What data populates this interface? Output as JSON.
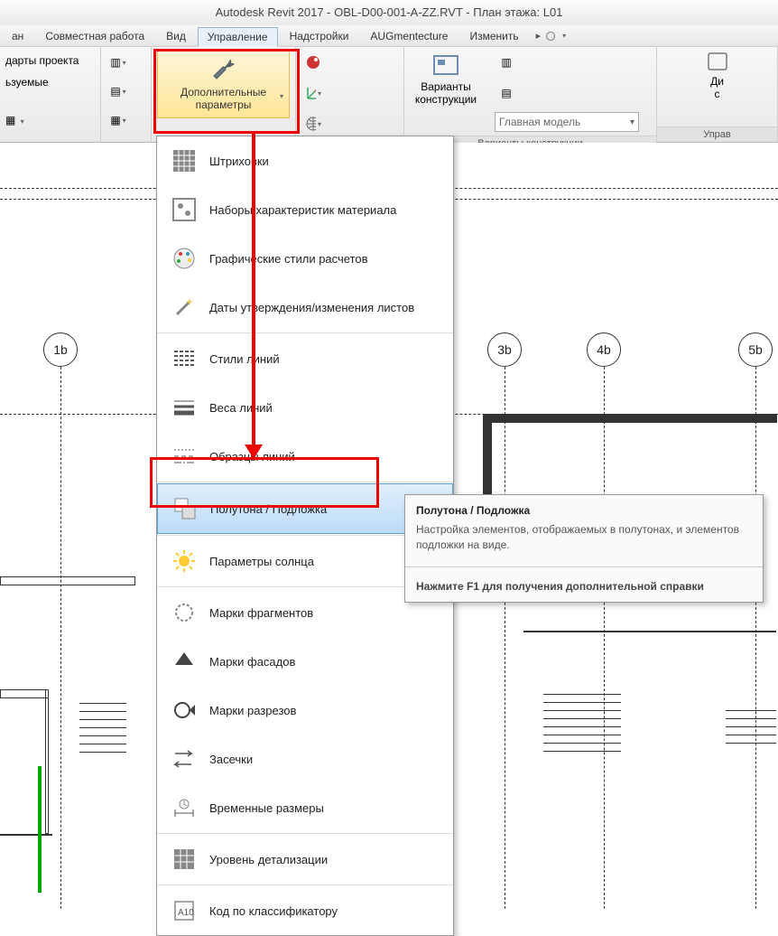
{
  "title": "Autodesk Revit 2017 -    OBL-D00-001-A-ZZ.RVT - План этажа: L01",
  "tabs": [
    "ан",
    "Совместная работа",
    "Вид",
    "Управление",
    "Надстройки",
    "AUGmentecture",
    "Изменить"
  ],
  "activeTabIndex": 3,
  "ribbon": {
    "leftPanelItems": [
      "дарты проекта",
      "ьзуемые"
    ],
    "extraParams": "Дополнительные\nпараметры",
    "designOptions": "Варианты\nконструкции",
    "designOptionsPanelLabel": "Варианты конструкции",
    "mainModelCombo": "Главная модель",
    "rightPanelLabel": "Управ",
    "rightBtnTop": "Ди",
    "rightBtnBot": "с"
  },
  "menu": {
    "items": [
      {
        "icon": "hatch",
        "label": "Штриховки"
      },
      {
        "icon": "material",
        "label": "Наборы характеристик материала"
      },
      {
        "icon": "palette",
        "label": "Графические стили расчетов"
      },
      {
        "icon": "wand",
        "label": "Даты утверждения/изменения листов"
      },
      {
        "icon": "linestyles",
        "label": "Стили линий",
        "sepBefore": true
      },
      {
        "icon": "lineweights",
        "label": "Веса линий"
      },
      {
        "icon": "linepatterns",
        "label": "Образцы линий"
      },
      {
        "icon": "halftone",
        "label": "Полутона / Подложка",
        "sepBefore": true,
        "selected": true
      },
      {
        "icon": "sun",
        "label": "Параметры солнца",
        "sepBefore": true
      },
      {
        "icon": "callout",
        "label": "Марки фрагментов",
        "sepBefore": true
      },
      {
        "icon": "elev",
        "label": "Марки фасадов"
      },
      {
        "icon": "section",
        "label": "Марки разрезов"
      },
      {
        "icon": "arrows",
        "label": "Засечки"
      },
      {
        "icon": "tempdim",
        "label": "Временные размеры"
      },
      {
        "icon": "detail",
        "label": "Уровень детализации",
        "sepBefore": true
      },
      {
        "icon": "code",
        "label": "Код по классификатору",
        "sepBefore": true
      }
    ]
  },
  "tooltip": {
    "title": "Полутона / Подложка",
    "body": "Настройка элементов, отображаемых в полутонах, и элементов подложки на виде.",
    "help": "Нажмите F1 для получения дополнительной справки"
  },
  "grids": [
    "1b",
    "3b",
    "4b",
    "5b"
  ]
}
